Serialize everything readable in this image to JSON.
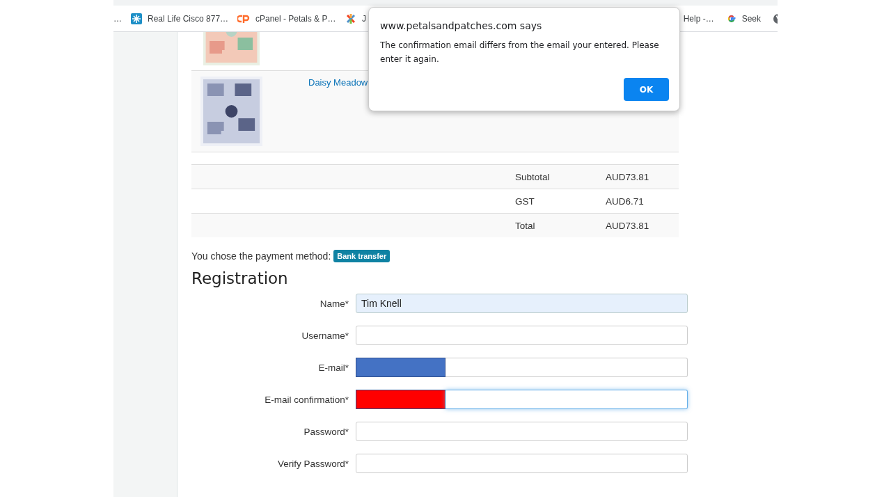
{
  "bookmarks": [
    "…",
    "Real Life Cisco 877…",
    "cPanel - Petals & P…",
    "J",
    "Help -…",
    "Seek"
  ],
  "products": [
    {
      "kind": "picture"
    },
    {
      "kind": "picture",
      "title": "Daisy Meadow"
    }
  ],
  "totals": [
    {
      "label": "Subtotal",
      "value": "AUD73.81"
    },
    {
      "label": "GST",
      "value": "AUD6.71"
    },
    {
      "label": "Total",
      "value": "AUD73.81"
    }
  ],
  "payment": {
    "text": "You chose the payment method:",
    "method": "Bank transfer"
  },
  "registration": {
    "title": "Registration",
    "fields": [
      {
        "label": "Name*",
        "value": "Tim Knell",
        "autofilled": true,
        "focused": false
      },
      {
        "label": "Username*",
        "autofilled": false,
        "focused": false
      },
      {
        "label": "E-mail*",
        "autofilled": false,
        "focused": false,
        "redaction": {
          "color": "#4472c4"
        }
      },
      {
        "label": "E-mail confirmation*",
        "autofilled": false,
        "focused": true,
        "redaction": {
          "color": "#ff0000"
        }
      },
      {
        "label": "Password*",
        "autofilled": false,
        "focused": false
      },
      {
        "label": "Verify Password*",
        "autofilled": false,
        "focused": false
      }
    ]
  },
  "dialog": {
    "title": "www.petalsandpatches.com says",
    "message": "The confirmation email differs from the email your entered. Please enter it again.",
    "button": "OK"
  }
}
